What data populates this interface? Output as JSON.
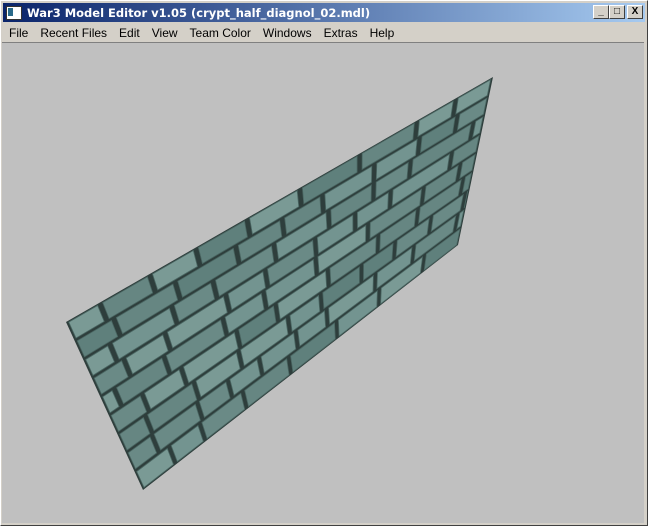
{
  "window": {
    "title": "War3 Model Editor v1.05 (crypt_half_diagnol_02.mdl)",
    "minimize": "_",
    "maximize": "□",
    "close": "X"
  },
  "menu": [
    {
      "label": "File"
    },
    {
      "label": "Recent Files"
    },
    {
      "label": "Edit"
    },
    {
      "label": "View"
    },
    {
      "label": "Team Color"
    },
    {
      "label": "Windows"
    },
    {
      "label": "Extras"
    },
    {
      "label": "Help"
    }
  ],
  "colors": {
    "viewport": "#c0c0c0",
    "stone": "#6a8a86",
    "mortar": "#2e3e3c"
  }
}
